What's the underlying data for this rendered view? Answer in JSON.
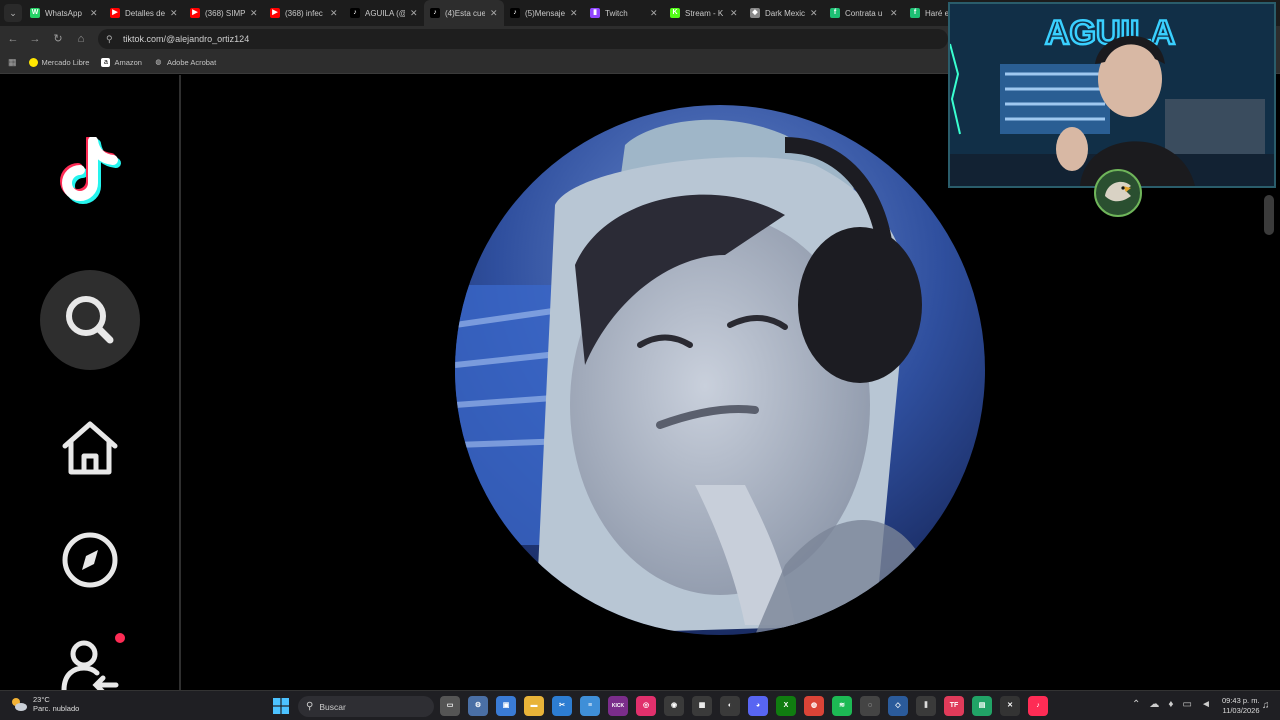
{
  "browser": {
    "tabs": [
      {
        "label": "WhatsApp",
        "favicon_color": "#25d366",
        "favicon": "W"
      },
      {
        "label": "Detalles de",
        "favicon_color": "#ff0000",
        "favicon": "▶"
      },
      {
        "label": "(368) SIMP",
        "favicon_color": "#ff0000",
        "favicon": "▶"
      },
      {
        "label": "(368) infec",
        "favicon_color": "#ff0000",
        "favicon": "▶"
      },
      {
        "label": "AGUILA (@",
        "favicon_color": "#000000",
        "favicon": "♪"
      },
      {
        "label": "(4)Esta cue",
        "favicon_color": "#000000",
        "favicon": "♪",
        "active": true
      },
      {
        "label": "(5)Mensaje",
        "favicon_color": "#000000",
        "favicon": "♪"
      },
      {
        "label": "Twitch",
        "favicon_color": "#9146ff",
        "favicon": "▮"
      },
      {
        "label": "Stream - K",
        "favicon_color": "#53fc18",
        "favicon": "K"
      },
      {
        "label": "Dark Mexic",
        "favicon_color": "#888888",
        "favicon": "◆"
      },
      {
        "label": "Contrata u",
        "favicon_color": "#1dbf73",
        "favicon": "f"
      },
      {
        "label": "Haré el",
        "favicon_color": "#1dbf73",
        "favicon": "f"
      }
    ],
    "url": "tiktok.com/@alejandro_ortiz124",
    "bookmarks": [
      {
        "label": "Mercado Libre",
        "color": "#ffe600"
      },
      {
        "label": "Amazon",
        "color": "#ffffff"
      },
      {
        "label": "Adobe Acrobat",
        "color": "#cccccc"
      }
    ]
  },
  "tiktok": {
    "sidebar_icons": [
      "tiktok-logo-icon",
      "search-icon",
      "home-icon",
      "explore-compass-icon",
      "following-icon"
    ],
    "notification_dot_color": "#fe2c55"
  },
  "webcam": {
    "neon_sign_text": "AGUILA",
    "neon_color": "#39d0ff"
  },
  "taskbar": {
    "weather": {
      "temperature": "23°C",
      "condition": "Parc. nublado"
    },
    "search_placeholder": "Buscar",
    "apps": [
      {
        "name": "task-view",
        "color": "#555555",
        "glyph": "▭"
      },
      {
        "name": "settings",
        "color": "#4a6fa5",
        "glyph": "⚙"
      },
      {
        "name": "store",
        "color": "#3a7bd5",
        "glyph": "▣"
      },
      {
        "name": "file-explorer",
        "color": "#e8b339",
        "glyph": "▬"
      },
      {
        "name": "snipping",
        "color": "#2d7dd2",
        "glyph": "✂"
      },
      {
        "name": "notes",
        "color": "#3f8fd8",
        "glyph": "≡"
      },
      {
        "name": "kick",
        "color": "#7b2d8b",
        "glyph": "KICK"
      },
      {
        "name": "instagram",
        "color": "#e1306c",
        "glyph": "◎"
      },
      {
        "name": "obs",
        "color": "#3a3a3a",
        "glyph": "◉"
      },
      {
        "name": "capture",
        "color": "#3a3a3a",
        "glyph": "▦"
      },
      {
        "name": "app-generic",
        "color": "#3a3a3a",
        "glyph": "◐"
      },
      {
        "name": "discord",
        "color": "#5865f2",
        "glyph": "◕"
      },
      {
        "name": "xbox",
        "color": "#107c10",
        "glyph": "X"
      },
      {
        "name": "chrome",
        "color": "#db4437",
        "glyph": "◍"
      },
      {
        "name": "spotify",
        "color": "#1db954",
        "glyph": "≋"
      },
      {
        "name": "chrome-beta",
        "color": "#444444",
        "glyph": "◌"
      },
      {
        "name": "vscode-like",
        "color": "#2b5b9b",
        "glyph": "◇"
      },
      {
        "name": "audio-mixer",
        "color": "#3a3a3a",
        "glyph": "⫼"
      },
      {
        "name": "tiktok-live-studio",
        "color": "#e03b5a",
        "glyph": "TF"
      },
      {
        "name": "excel-like",
        "color": "#21a366",
        "glyph": "▤"
      },
      {
        "name": "capcut",
        "color": "#333333",
        "glyph": "✕"
      },
      {
        "name": "tiktok",
        "color": "#fe2c55",
        "glyph": "♪"
      }
    ],
    "time": "09:43 p. m.",
    "date": "11/03/2026"
  }
}
